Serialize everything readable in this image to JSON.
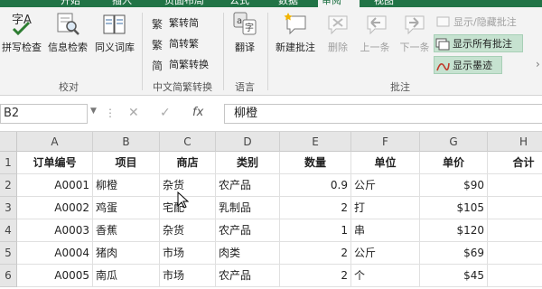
{
  "tabs": [
    "开始",
    "插入",
    "页面布局",
    "公式",
    "数据",
    "审阅",
    "视图"
  ],
  "active_tab": "审阅",
  "ribbon": {
    "proofing": {
      "label": "校对",
      "spell": "拼写检查",
      "research": "信息检索",
      "thesaurus": "同义词库"
    },
    "chinese_conversion": {
      "label": "中文简繁转换",
      "to_traditional": "繁转简",
      "to_simplified": "简转繁",
      "convert": "简繁转换"
    },
    "language": {
      "label": "语言",
      "translate": "翻译"
    },
    "comments": {
      "label": "批注",
      "new": "新建批注",
      "delete": "删除",
      "previous": "上一条",
      "next": "下一条",
      "show_hide": "显示/隐藏批注",
      "show_all": "显示所有批注",
      "show_ink": "显示墨迹"
    }
  },
  "formula_bar": {
    "name_box": "B2",
    "fx": "fx",
    "content": "柳橙"
  },
  "sheet": {
    "columns": [
      "A",
      "B",
      "C",
      "D",
      "E",
      "F",
      "G",
      "H"
    ],
    "row_numbers": [
      "1",
      "2",
      "3",
      "4",
      "5",
      "6"
    ],
    "rows": [
      [
        "订单编号",
        "项目",
        "商店",
        "类别",
        "数量",
        "单位",
        "单价",
        "合计"
      ],
      [
        "A0001",
        "柳橙",
        "杂货",
        "农产品",
        "0.9",
        "公斤",
        "$90",
        ""
      ],
      [
        "A0002",
        "鸡蛋",
        "宅配",
        "乳制品",
        "2",
        "打",
        "$105",
        "$"
      ],
      [
        "A0003",
        "香蕉",
        "杂货",
        "农产品",
        "1",
        "串",
        "$120",
        "$"
      ],
      [
        "A0004",
        "猪肉",
        "市场",
        "肉类",
        "2",
        "公斤",
        "$69",
        "$"
      ],
      [
        "A0005",
        "南瓜",
        "市场",
        "农产品",
        "2",
        "个",
        "$45",
        ""
      ]
    ]
  },
  "colors": {
    "excel_green": "#217346",
    "highlight": "#c6e2d0"
  }
}
